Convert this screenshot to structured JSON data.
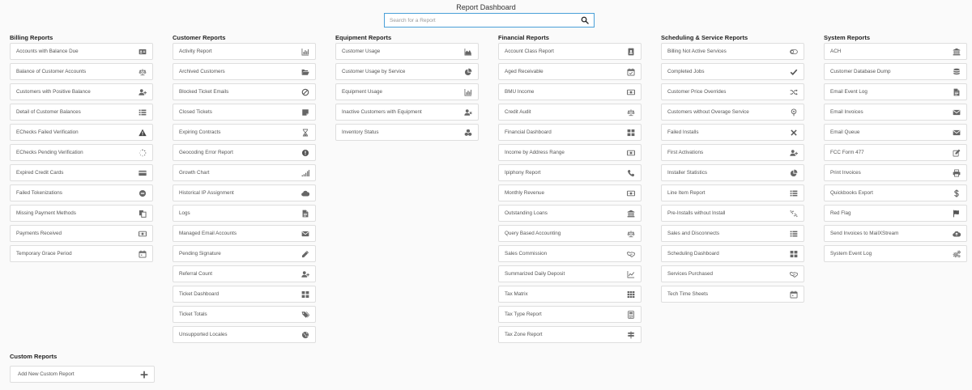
{
  "header": {
    "title": "Report Dashboard",
    "search_placeholder": "Search for a Report"
  },
  "columns": [
    {
      "key": "billing",
      "title": "Billing Reports",
      "items": [
        {
          "label": "Accounts with Balance Due",
          "icon": "id-card-icon"
        },
        {
          "label": "Balance of Customer Accounts",
          "icon": "balance-scale-icon"
        },
        {
          "label": "Customers with Positive Balance",
          "icon": "user-plus-icon"
        },
        {
          "label": "Detail of Customer Balances",
          "icon": "list-icon"
        },
        {
          "label": "EChecks Failed Verification",
          "icon": "warning-icon"
        },
        {
          "label": "EChecks Pending Verification",
          "icon": "spinner-icon"
        },
        {
          "label": "Expired Credit Cards",
          "icon": "credit-card-icon"
        },
        {
          "label": "Failed Tokenizations",
          "icon": "minus-circle-icon"
        },
        {
          "label": "Missing Payment Methods",
          "icon": "copy-icon"
        },
        {
          "label": "Payments Received",
          "icon": "money-icon"
        },
        {
          "label": "Temporary Grace Period",
          "icon": "calendar-icon"
        }
      ]
    },
    {
      "key": "customer",
      "title": "Customer Reports",
      "items": [
        {
          "label": "Activity Report",
          "icon": "bar-chart-icon"
        },
        {
          "label": "Archived Customers",
          "icon": "folder-open-icon"
        },
        {
          "label": "Blocked Ticket Emails",
          "icon": "ban-icon"
        },
        {
          "label": "Closed Tickets",
          "icon": "sticky-note-icon"
        },
        {
          "label": "Expiring Contracts",
          "icon": "hourglass-icon"
        },
        {
          "label": "Geocoding Error Report",
          "icon": "exclamation-circle-icon"
        },
        {
          "label": "Growth Chart",
          "icon": "signal-icon"
        },
        {
          "label": "Historical IP Assignment",
          "icon": "cloud-icon"
        },
        {
          "label": "Logs",
          "icon": "file-text-icon"
        },
        {
          "label": "Managed Email Accounts",
          "icon": "envelope-icon"
        },
        {
          "label": "Pending Signature",
          "icon": "pencil-icon"
        },
        {
          "label": "Referral Count",
          "icon": "user-plus-icon"
        },
        {
          "label": "Ticket Dashboard",
          "icon": "grid-icon"
        },
        {
          "label": "Ticket Totals",
          "icon": "tags-icon"
        },
        {
          "label": "Unsupported Locales",
          "icon": "globe-icon"
        }
      ]
    },
    {
      "key": "equipment",
      "title": "Equipment Reports",
      "items": [
        {
          "label": "Customer Usage",
          "icon": "area-chart-icon"
        },
        {
          "label": "Customer Usage by Service",
          "icon": "pie-chart-icon"
        },
        {
          "label": "Equipment Usage",
          "icon": "bar-chart-icon"
        },
        {
          "label": "Inactive Customers with Equipment",
          "icon": "user-times-icon"
        },
        {
          "label": "Inventory Status",
          "icon": "cubes-icon"
        }
      ]
    },
    {
      "key": "financial",
      "title": "Financial Reports",
      "items": [
        {
          "label": "Account Class Report",
          "icon": "address-book-icon"
        },
        {
          "label": "Aged Receivable",
          "icon": "calendar-check-icon"
        },
        {
          "label": "BMU Income",
          "icon": "money-icon"
        },
        {
          "label": "Credit Audit",
          "icon": "balance-scale-icon"
        },
        {
          "label": "Financial Dashboard",
          "icon": "grid-icon"
        },
        {
          "label": "Income by Address Range",
          "icon": "money-icon"
        },
        {
          "label": "Ipiphony Report",
          "icon": "phone-icon"
        },
        {
          "label": "Monthly Revenue",
          "icon": "money-icon"
        },
        {
          "label": "Outstanding Loans",
          "icon": "bank-icon"
        },
        {
          "label": "Query Based Accounting",
          "icon": "balance-scale-icon"
        },
        {
          "label": "Sales Commission",
          "icon": "handshake-icon"
        },
        {
          "label": "Summarized Daily Deposit",
          "icon": "line-chart-icon"
        },
        {
          "label": "Tax Matrix",
          "icon": "th-icon"
        },
        {
          "label": "Tax Type Report",
          "icon": "calculator-icon"
        },
        {
          "label": "Tax Zone Report",
          "icon": "map-signs-icon"
        }
      ]
    },
    {
      "key": "scheduling",
      "title": "Scheduling & Service Reports",
      "items": [
        {
          "label": "Billing Not Active Services",
          "icon": "toggle-off-icon"
        },
        {
          "label": "Completed Jobs",
          "icon": "check-icon"
        },
        {
          "label": "Customer Price Overrides",
          "icon": "random-icon"
        },
        {
          "label": "Customers without Overage Service",
          "icon": "map-pin-icon"
        },
        {
          "label": "Failed Installs",
          "icon": "times-icon"
        },
        {
          "label": "First Activations",
          "icon": "user-plus-icon"
        },
        {
          "label": "Installer Statistics",
          "icon": "pie-chart-icon"
        },
        {
          "label": "Line Item Report",
          "icon": "list-icon"
        },
        {
          "label": "Pre-Installs without Install",
          "icon": "unlink-icon"
        },
        {
          "label": "Sales and Disconnects",
          "icon": "list-icon"
        },
        {
          "label": "Scheduling Dashboard",
          "icon": "grid-icon"
        },
        {
          "label": "Services Purchased",
          "icon": "handshake-icon"
        },
        {
          "label": "Tech Time Sheets",
          "icon": "calendar-icon"
        }
      ]
    },
    {
      "key": "system",
      "title": "System Reports",
      "items": [
        {
          "label": "ACH",
          "icon": "bank-icon"
        },
        {
          "label": "Customer Database Dump",
          "icon": "database-icon"
        },
        {
          "label": "Email Event Log",
          "icon": "file-text-icon"
        },
        {
          "label": "Email Invoices",
          "icon": "envelope-icon"
        },
        {
          "label": "Email Queue",
          "icon": "envelope-icon"
        },
        {
          "label": "FCC Form 477",
          "icon": "edit-icon"
        },
        {
          "label": "Print Invoices",
          "icon": "print-icon"
        },
        {
          "label": "Quickbooks Export",
          "icon": "dollar-icon"
        },
        {
          "label": "Red Flag",
          "icon": "flag-icon"
        },
        {
          "label": "Send Invoices to MailXStream",
          "icon": "cloud-upload-icon"
        },
        {
          "label": "System Event Log",
          "icon": "cogs-icon"
        }
      ]
    }
  ],
  "custom": {
    "title": "Custom Reports",
    "add_label": "Add New Custom Report",
    "add_icon": "plus-icon"
  }
}
